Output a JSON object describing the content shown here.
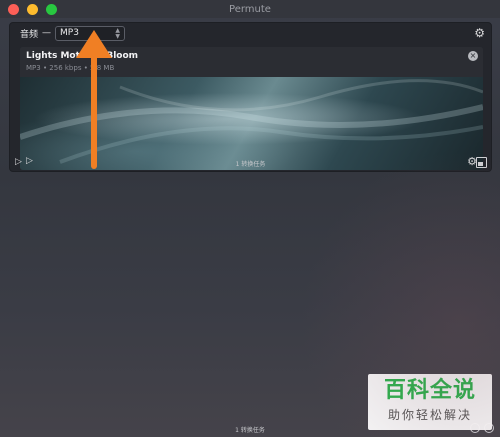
{
  "window": {
    "title": "Permute"
  },
  "panel": {
    "category": "音频",
    "dash": "—",
    "format_value": "MP3",
    "footer_text": "1 转换任务"
  },
  "file": {
    "name": "Lights Motion – Bloom",
    "meta": "MP3 • 256 kbps • 5.8 MB"
  },
  "statusbar": {
    "text": "1 转换任务"
  },
  "watermark": {
    "top": "百科全说",
    "bottom": "助你轻松解决"
  },
  "colors": {
    "accent": "#f07f24",
    "watermark_green": "#2bb24c"
  },
  "icons": {
    "gear": "gear-icon",
    "play": "play-icon",
    "close": "close-icon",
    "select_arrows": "chevron-updown-icon"
  }
}
